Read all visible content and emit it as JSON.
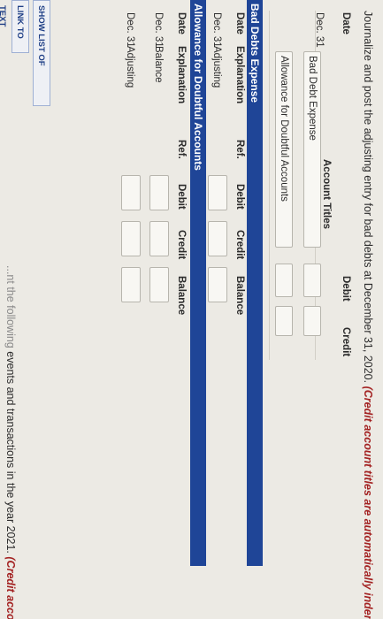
{
  "instruction": {
    "text": "Journalize and post the adjusting entry for bad debts at December 31, 2020.",
    "hint": "(Credit account titles are automatically inden"
  },
  "journal": {
    "headers": {
      "date": "Date",
      "account_titles": "Account Titles",
      "debit": "Debit",
      "credit": "Credit"
    },
    "rows": [
      {
        "date": "Dec. 31",
        "account": "Bad Debt Expense"
      },
      {
        "date": "",
        "account": "Allowance for Doubtful Accounts"
      }
    ]
  },
  "ledger_bad_debts": {
    "title": "Bad Debts Expense",
    "headers": {
      "date": "Date",
      "explanation": "Explanation",
      "ref": "Ref.",
      "debit": "Debit",
      "credit": "Credit",
      "balance": "Balance"
    },
    "rows": [
      {
        "date": "Dec. 31",
        "explanation": "Adjusting"
      }
    ]
  },
  "ledger_allowance": {
    "title": "Allowance for Doubtful Accounts",
    "headers": {
      "date": "Date",
      "explanation": "Explanation",
      "ref": "Ref.",
      "debit": "Debit",
      "credit": "Credit",
      "balance": "Balance"
    },
    "rows": [
      {
        "date": "Dec. 31",
        "explanation": "Balance"
      },
      {
        "date": "Dec. 31",
        "explanation": "Adjusting"
      }
    ]
  },
  "buttons": {
    "show_accounts": "SHOW LIST OF ACCOUNTS",
    "link_to_text": "LINK TO TEXT"
  },
  "footer": {
    "prefix": "...nt the following",
    "text": " events and transactions in the year 2021.",
    "hint": "(Credit account t"
  }
}
